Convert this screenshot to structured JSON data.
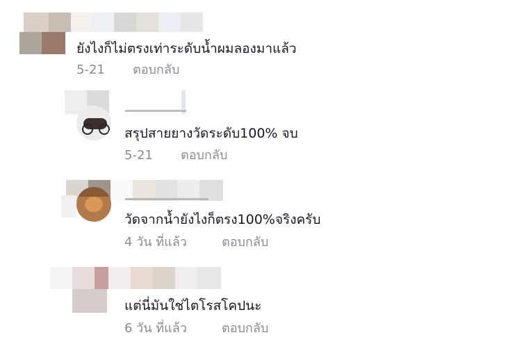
{
  "comments": [
    {
      "text": "ยังไงก็ไม่ตรงเท่าระดับน้ำผมลองมาแล้ว",
      "time": "5-21",
      "reply_label": "ตอบกลับ"
    },
    {
      "text": "สรุปสายยางวัดระดับ100% จบ",
      "time": "5-21",
      "reply_label": "ตอบกลับ"
    },
    {
      "text": "วัดจากน้ำยังไงก็ตรง100%จริงครับ",
      "time": "4 วัน ที่แล้ว",
      "reply_label": "ตอบกลับ"
    },
    {
      "text": "แต่นี่มันใช่ไตโรสโคปนะ",
      "time": "6 วัน ที่แล้ว",
      "reply_label": "ตอบกลับ"
    }
  ],
  "colors": {
    "text": "#161823",
    "meta": "#8a8b91",
    "background": "#ffffff"
  }
}
